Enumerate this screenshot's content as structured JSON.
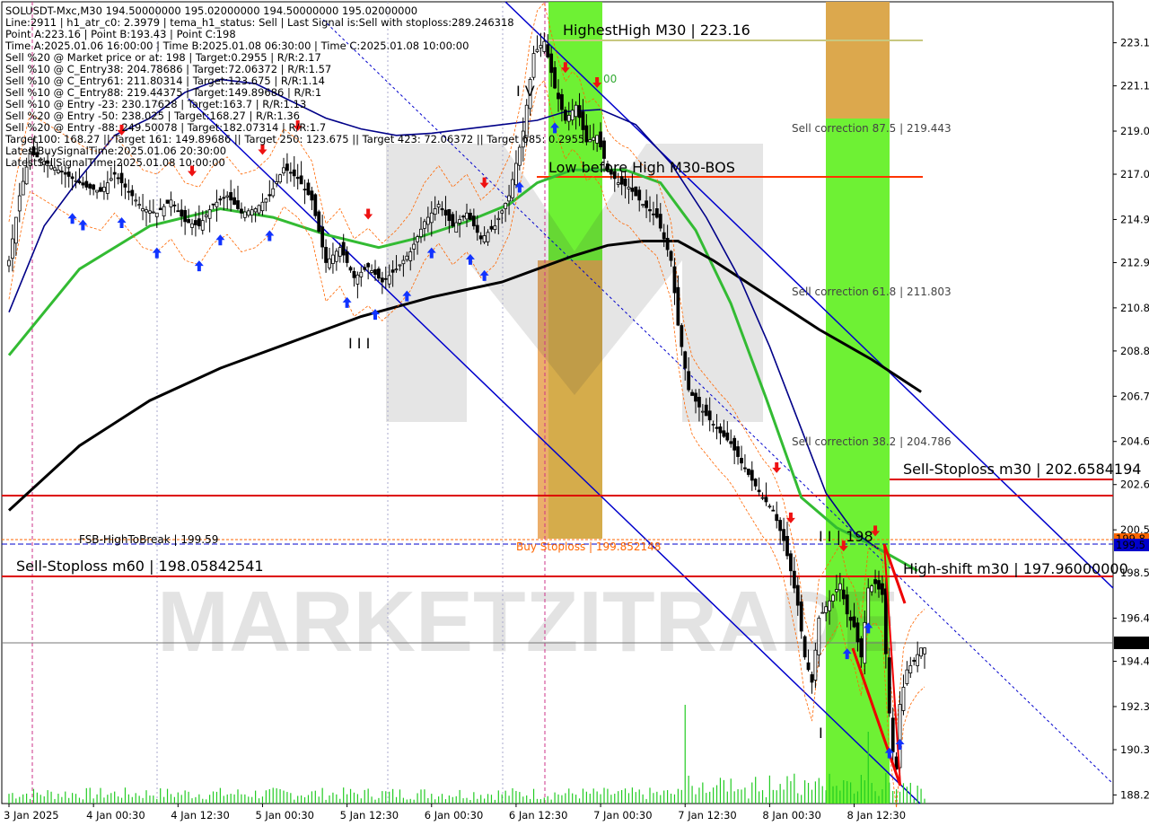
{
  "header": {
    "lines": [
      "SOLUSDT-Mxc,M30  194.50000000 195.02000000 194.50000000 195.02000000",
      "Line:2911 | h1_atr_c0: 2.3979 | tema_h1_status: Sell | Last Signal is:Sell with stoploss:289.246318",
      "Point A:223.16 | Point B:193.43 | Point C:198",
      "Time A:2025.01.06 16:00:00 | Time B:2025.01.08 06:30:00 | Time C:2025.01.08 10:00:00",
      "Sell %20 @ Market price or at: 198 | Target:0.2955 | R/R:2.17",
      "Sell %10 @ C_Entry38: 204.78686 | Target:72.06372 | R/R:1.57",
      "Sell %10 @ C_Entry61: 211.80314 | Target:123.675 | R/R:1.14",
      "Sell %10 @ C_Entry88: 219.44375 | Target:149.89686 | R/R:1",
      "Sell %10 @ Entry -23: 230.17628 | Target:163.7 | R/R:1.13",
      "Sell %20 @ Entry -50: 238.025 | Target:168.27 | R/R:1.36",
      "Sell %20 @ Entry -88: 249.50078 | Target:182.07314 | R/R:1.7",
      "Target100: 168.27 || Target 161: 149.89686 || Target 250: 123.675 || Target 423: 72.06372 || Target 685: 0.2955",
      "LatestBuySignalTime:2025.01.06 20:30:00",
      "LatestSellSignalTime:2025.01.08 10:00:00"
    ]
  },
  "labels": {
    "highest_high": "HighestHigh   M30 | 223.16",
    "low_before_high": "Low before High   M30-BOS",
    "sell_corr_875": "Sell correction 87.5 | 219.443",
    "sell_corr_618": "Sell correction 61.8 | 211.803",
    "sell_corr_382": "Sell correction 38.2 | 204.786",
    "sell_stoploss_m30": "Sell-Stoploss m30 | 202.6584194",
    "sell_stoploss_m60": "Sell-Stoploss m60 | 198.05842541",
    "fsb": "FSB-HighToBreak | 199.59",
    "buy_stoploss": "Buy Stoploss | 199.852148",
    "high_shift": "High-shift m30 | 197.96000000",
    "wave_iv": "I V",
    "wave_iii": "I I I",
    "wave_ii": "I I | 198",
    "wave_i": "I",
    "wave_v_partial": "00",
    "watermark": "MARKETZITRADE"
  },
  "price_tags": {
    "bid": "199.5",
    "current": "195.0",
    "orange": "199.8"
  },
  "colors": {
    "ma_green": "#33bb33",
    "ma_black": "#000000",
    "channel_blue": "#0000cc",
    "red_line": "#dd0000",
    "orange": "#ff6600",
    "zone_green": "#55ee11",
    "zone_orange": "#e8a050",
    "candle_bull": "#000000",
    "volume": "#22cc22"
  },
  "chart_data": {
    "type": "line",
    "symbol": "SOLUSDT-Mxc",
    "timeframe": "M30",
    "ohlc_last": {
      "open": 194.5,
      "high": 195.02,
      "low": 194.5,
      "close": 195.02
    },
    "ylim": [
      187.8,
      225.0
    ],
    "y_ticks": [
      188.2,
      190.3,
      192.3,
      194.4,
      196.4,
      198.5,
      200.5,
      202.6,
      204.6,
      206.7,
      208.8,
      210.8,
      212.9,
      214.9,
      217.0,
      219.0,
      221.1,
      223.1
    ],
    "x_ticks": [
      "3 Jan 2025",
      "4 Jan 00:30",
      "4 Jan 12:30",
      "5 Jan 00:30",
      "5 Jan 12:30",
      "6 Jan 00:30",
      "6 Jan 12:30",
      "7 Jan 00:30",
      "7 Jan 12:30",
      "8 Jan 00:30",
      "8 Jan 12:30"
    ],
    "x_range": [
      0,
      260
    ],
    "x_tick_positions": [
      0,
      24,
      48,
      72,
      96,
      120,
      144,
      168,
      192,
      216,
      240
    ],
    "price_path": [
      [
        0,
        213.0
      ],
      [
        3,
        216.0
      ],
      [
        6,
        218.0
      ],
      [
        10,
        217.6
      ],
      [
        14,
        217.2
      ],
      [
        18,
        216.8
      ],
      [
        22,
        216.4
      ],
      [
        26,
        216.2
      ],
      [
        30,
        217.0
      ],
      [
        34,
        216.2
      ],
      [
        38,
        215.4
      ],
      [
        42,
        215.2
      ],
      [
        46,
        215.8
      ],
      [
        50,
        214.8
      ],
      [
        54,
        214.6
      ],
      [
        58,
        215.6
      ],
      [
        62,
        216.0
      ],
      [
        66,
        215.2
      ],
      [
        70,
        215.4
      ],
      [
        74,
        216.0
      ],
      [
        78,
        217.3
      ],
      [
        82,
        216.8
      ],
      [
        86,
        215.8
      ],
      [
        90,
        212.9
      ],
      [
        94,
        213.6
      ],
      [
        98,
        212.2
      ],
      [
        102,
        212.7
      ],
      [
        106,
        212.0
      ],
      [
        110,
        212.6
      ],
      [
        114,
        213.4
      ],
      [
        118,
        214.8
      ],
      [
        122,
        215.6
      ],
      [
        126,
        214.6
      ],
      [
        130,
        215.2
      ],
      [
        134,
        214.0
      ],
      [
        138,
        214.6
      ],
      [
        142,
        216.0
      ],
      [
        146,
        219.0
      ],
      [
        149,
        222.6
      ],
      [
        152,
        223.16
      ],
      [
        155,
        221.0
      ],
      [
        158,
        219.5
      ],
      [
        161,
        220.2
      ],
      [
        164,
        218.5
      ],
      [
        167,
        218.8
      ],
      [
        170,
        217.2
      ],
      [
        173,
        216.6
      ],
      [
        176,
        216.4
      ],
      [
        180,
        215.6
      ],
      [
        184,
        215.0
      ],
      [
        188,
        213.0
      ],
      [
        190,
        210.0
      ],
      [
        193,
        207.0
      ],
      [
        196,
        206.2
      ],
      [
        199,
        205.6
      ],
      [
        202,
        205.0
      ],
      [
        205,
        204.5
      ],
      [
        208,
        203.6
      ],
      [
        211,
        202.8
      ],
      [
        214,
        202.0
      ],
      [
        217,
        201.4
      ],
      [
        220,
        200.0
      ],
      [
        222,
        198.6
      ],
      [
        224,
        197.0
      ],
      [
        226,
        194.6
      ],
      [
        228,
        193.43
      ],
      [
        230,
        196.4
      ],
      [
        233,
        197.2
      ],
      [
        236,
        198.0
      ],
      [
        238,
        196.6
      ],
      [
        240,
        196.0
      ],
      [
        242,
        194.6
      ],
      [
        244,
        197.8
      ],
      [
        246,
        198.0
      ],
      [
        248,
        197.5
      ],
      [
        250,
        192.0
      ],
      [
        251,
        190.2
      ],
      [
        252,
        189.4
      ],
      [
        253,
        192.4
      ],
      [
        255,
        194.0
      ],
      [
        257,
        194.4
      ],
      [
        259,
        195.02
      ]
    ],
    "series": [
      {
        "values": [
          [
            0,
            208.6
          ],
          [
            20,
            212.6
          ],
          [
            40,
            214.6
          ],
          [
            60,
            215.4
          ],
          [
            75,
            215.0
          ],
          [
            90,
            214.2
          ],
          [
            105,
            213.6
          ],
          [
            115,
            214.0
          ],
          [
            130,
            214.8
          ],
          [
            142,
            215.6
          ],
          [
            150,
            216.6
          ],
          [
            160,
            217.2
          ],
          [
            175,
            217.2
          ],
          [
            185,
            216.6
          ],
          [
            195,
            214.4
          ],
          [
            205,
            211.0
          ],
          [
            215,
            206.6
          ],
          [
            225,
            202.0
          ],
          [
            235,
            200.6
          ],
          [
            245,
            199.8
          ],
          [
            258,
            198.6
          ]
        ]
      },
      {
        "values": [
          [
            0,
            201.4
          ],
          [
            20,
            204.4
          ],
          [
            40,
            206.5
          ],
          [
            60,
            208.0
          ],
          [
            80,
            209.2
          ],
          [
            100,
            210.4
          ],
          [
            120,
            211.3
          ],
          [
            140,
            212.0
          ],
          [
            150,
            212.6
          ],
          [
            160,
            213.2
          ],
          [
            170,
            213.7
          ],
          [
            180,
            213.9
          ],
          [
            190,
            213.9
          ],
          [
            200,
            213.0
          ],
          [
            215,
            211.4
          ],
          [
            230,
            209.8
          ],
          [
            245,
            208.4
          ],
          [
            259,
            206.9
          ]
        ]
      },
      {
        "values": [
          [
            0,
            210.6
          ],
          [
            10,
            214.6
          ],
          [
            20,
            216.8
          ],
          [
            30,
            218.8
          ],
          [
            40,
            219.6
          ],
          [
            50,
            220.8
          ],
          [
            60,
            221.4
          ],
          [
            70,
            221.2
          ],
          [
            80,
            220.4
          ],
          [
            90,
            219.6
          ],
          [
            100,
            219.1
          ],
          [
            110,
            218.8
          ],
          [
            120,
            218.9
          ],
          [
            130,
            219.1
          ],
          [
            140,
            219.3
          ],
          [
            150,
            219.5
          ],
          [
            158,
            219.9
          ],
          [
            168,
            220.0
          ],
          [
            178,
            219.3
          ],
          [
            188,
            217.5
          ],
          [
            198,
            215.0
          ],
          [
            208,
            212.0
          ],
          [
            216,
            209.0
          ],
          [
            224,
            205.6
          ],
          [
            232,
            202.2
          ],
          [
            240,
            200.4
          ],
          [
            247,
            199.6
          ]
        ]
      }
    ],
    "levels": [
      {
        "value": 223.16,
        "label": "HighestHigh M30 | 223.16"
      },
      {
        "value": 216.8,
        "label": "Low before High M30-BOS"
      },
      {
        "value": 219.443,
        "label": "Sell correction 87.5"
      },
      {
        "value": 211.803,
        "label": "Sell correction 61.8"
      },
      {
        "value": 204.786,
        "label": "Sell correction 38.2"
      },
      {
        "value": 202.6584194,
        "label": "Sell-Stoploss m30"
      },
      {
        "value": 201.8,
        "label": ""
      },
      {
        "value": 199.852148,
        "label": "Buy Stoploss"
      },
      {
        "value": 199.59,
        "label": "FSB-HighToBreak"
      },
      {
        "value": 198.05842541,
        "label": "Sell-Stoploss m60"
      },
      {
        "value": 197.96,
        "label": "High-shift m30"
      },
      {
        "value": 195.02,
        "label": "current"
      }
    ]
  }
}
